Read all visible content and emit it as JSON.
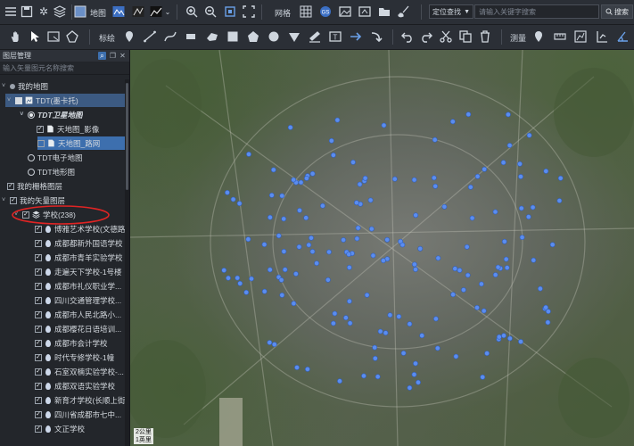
{
  "toolbar1": {
    "map_label": "地图",
    "grid_label": "网格",
    "locate_select": "定位查找",
    "search_placeholder": "请输入关键字搜索",
    "search_button": "搜索"
  },
  "toolbar2": {
    "mark_label": "标绘",
    "measure_label": "测量"
  },
  "panel": {
    "title": "图层管理",
    "filter_placeholder": "输入矢量图元名称搜索"
  },
  "tree": [
    {
      "label": "我的地图"
    },
    {
      "label": "TDT(墨卡托)"
    },
    {
      "label": "TDT卫星地图"
    },
    {
      "label": "天地图_影像"
    },
    {
      "label": "天地图_路网"
    },
    {
      "label": "TDT电子地图"
    },
    {
      "label": "TDT地形图"
    },
    {
      "label": "我的栅格图层"
    },
    {
      "label": "我的矢量图层"
    },
    {
      "label": "学校(238)"
    },
    {
      "label": "博雅艺术学校(文德路)"
    },
    {
      "label": "成都都新外国语学校"
    },
    {
      "label": "成都市青羊实验学校"
    },
    {
      "label": "走遍天下学校-1号楼"
    },
    {
      "label": "成都市礼仪职业学..."
    },
    {
      "label": "四川交通管理学校..."
    },
    {
      "label": "成都市人民北路小..."
    },
    {
      "label": "成都樱花日语培训..."
    },
    {
      "label": "成都市会计学校"
    },
    {
      "label": "时代专修学校-1幢"
    },
    {
      "label": "石室双楠实验学校-..."
    },
    {
      "label": "成都双语实验学校"
    },
    {
      "label": "新育才学校(长顺上街)"
    },
    {
      "label": "四川省成都市七中..."
    },
    {
      "label": "文正学校"
    }
  ],
  "map": {
    "scale_text": "2公里",
    "scale_sub": "1英里",
    "school_marker_color": "#5b8def",
    "annotation_color": "#e02424"
  }
}
